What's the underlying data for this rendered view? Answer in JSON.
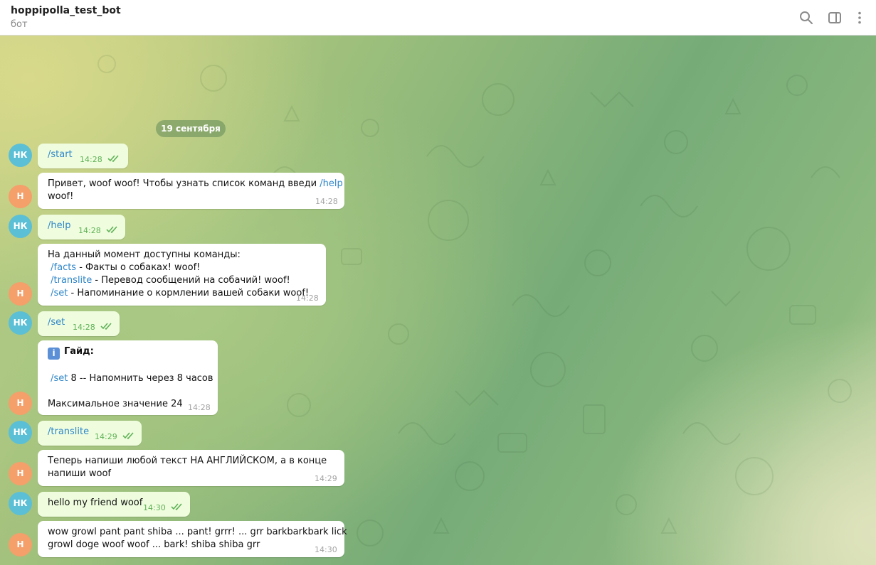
{
  "header": {
    "title": "hoppipolla_test_bot",
    "subtitle": "бот",
    "icons": [
      "search-icon",
      "sidebar-toggle-icon",
      "more-vertical-icon"
    ]
  },
  "colors": {
    "outgoing_bubble": "#effdde",
    "incoming_bubble": "#ffffff",
    "link": "#2f86c9",
    "avatar_nk": "#5bbfd6",
    "avatar_h": "#f59f6a",
    "read_ticks": "#5fb157"
  },
  "date_separator": "19 сентября",
  "avatars": {
    "user": "НК",
    "bot": "Н"
  },
  "messages": [
    {
      "id": "m1",
      "direction": "out",
      "text": "/start",
      "time": "14:28"
    },
    {
      "id": "m2",
      "direction": "in",
      "text_a": "Привет, woof woof! Чтобы узнать список команд введи ",
      "cmd": "/help",
      "text_b": "woof!",
      "time": "14:28"
    },
    {
      "id": "m3",
      "direction": "out",
      "text": "/help",
      "time": "14:28"
    },
    {
      "id": "m4",
      "direction": "in",
      "intro": "На данный момент доступны команды:",
      "items": [
        {
          "cmd": "/facts",
          "desc": " - Факты о собаках! woof!"
        },
        {
          "cmd": "/translite",
          "desc": " - Перевод сообщений на собачий! woof!"
        },
        {
          "cmd": "/set",
          "desc": " - Напоминание о кормлении вашей собаки woof!"
        }
      ],
      "time": "14:28"
    },
    {
      "id": "m5",
      "direction": "out",
      "text": "/set",
      "time": "14:28"
    },
    {
      "id": "m6",
      "direction": "in",
      "guide_title": "Гайд:",
      "example_cmd": "/set",
      "example_rest": " 8   --   Напомнить через 8 часов",
      "note": "Максимальное значение 24",
      "time": "14:28"
    },
    {
      "id": "m7",
      "direction": "out",
      "text": "/translite",
      "time": "14:29"
    },
    {
      "id": "m8",
      "direction": "in",
      "line1": "Теперь напиши любой текст НА АНГЛИЙСКОМ, а в конце",
      "line2": "напиши woof",
      "time": "14:29"
    },
    {
      "id": "m9",
      "direction": "out",
      "text": "hello my friend woof",
      "time": "14:30"
    },
    {
      "id": "m10",
      "direction": "in",
      "line1": "wow growl pant pant shiba ... pant! grrr! ... grr barkbarkbark lick",
      "line2": "growl doge woof woof ... bark! shiba shiba grr",
      "time": "14:30"
    }
  ]
}
